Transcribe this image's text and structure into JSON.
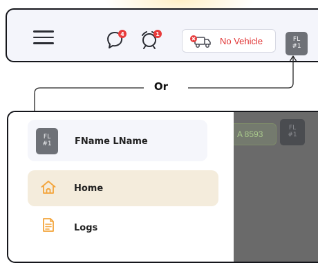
{
  "header": {
    "chat_badge": "4",
    "alarm_badge": "1",
    "vehicle_status": "No Vehicle",
    "avatar": {
      "initials": "FL",
      "number": "#1"
    }
  },
  "separator": {
    "label": "Or"
  },
  "drawer": {
    "user": {
      "initials": "FL",
      "number": "#1",
      "name": "FName LName"
    },
    "items": [
      {
        "label": "Home",
        "icon": "home-icon",
        "active": true
      },
      {
        "label": "Logs",
        "icon": "logs-icon",
        "active": false
      }
    ]
  },
  "background": {
    "plate_text": "A 8593",
    "avatar": {
      "initials": "FL",
      "number": "#1"
    }
  },
  "colors": {
    "accent": "#f3a43a",
    "alert": "#e83b3b",
    "active_item_bg": "#f4ecdc",
    "card_bg": "#f4f5fb"
  }
}
